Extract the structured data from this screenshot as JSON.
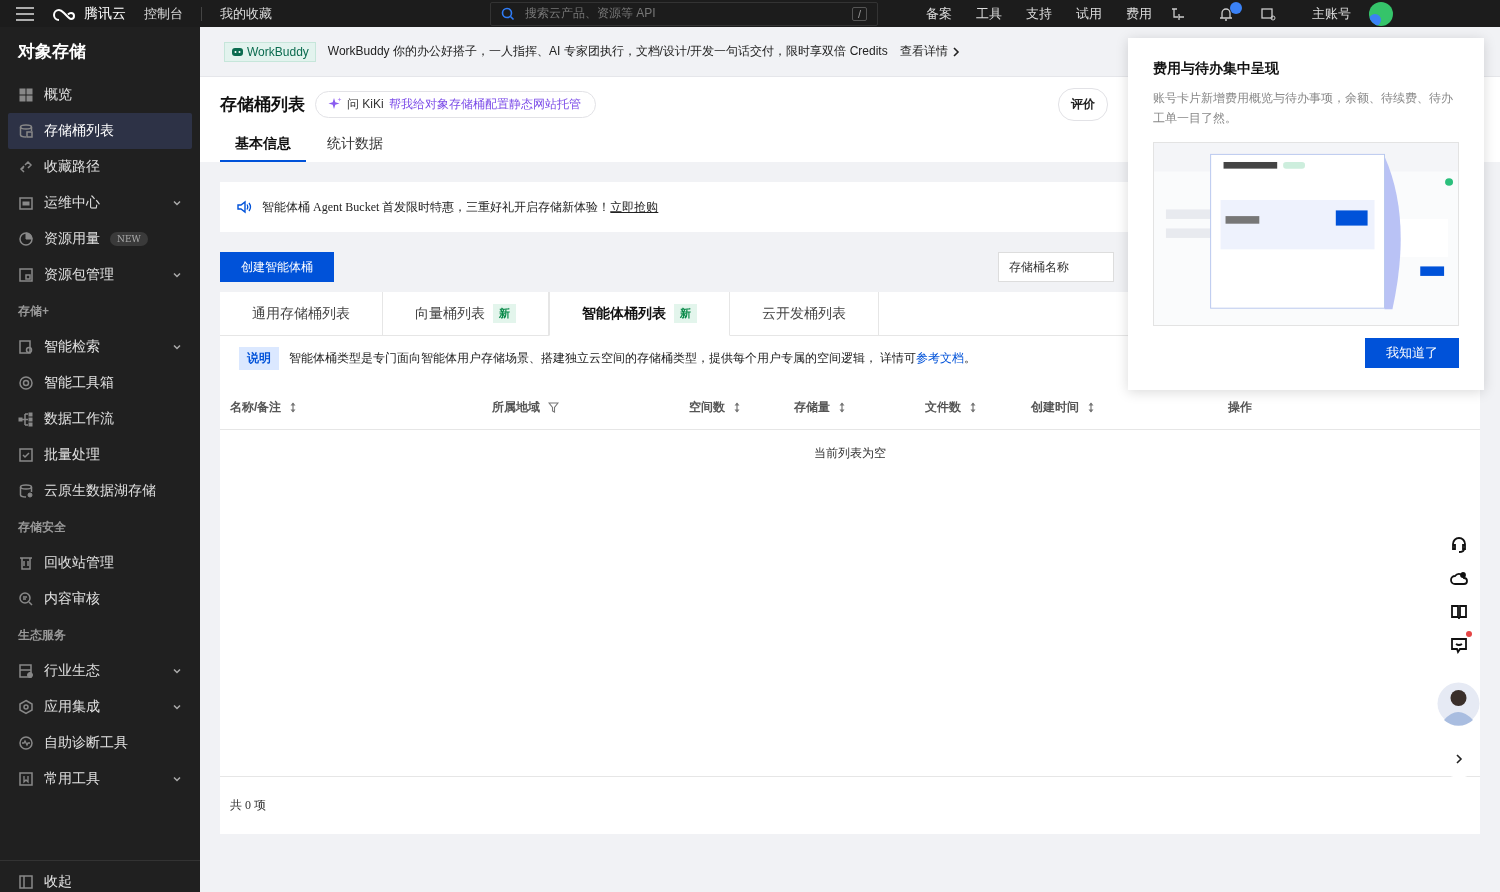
{
  "topbar": {
    "logo": "腾讯云",
    "console": "控制台",
    "favorites": "我的收藏",
    "search_placeholder": "搜索云产品、资源等 API",
    "search_key": "/",
    "links": [
      "备案",
      "工具",
      "支持",
      "试用",
      "费用"
    ],
    "account": "主账号"
  },
  "sidebar": {
    "title": "对象存储",
    "items": [
      {
        "kind": "item",
        "label": "概览",
        "selected": false
      },
      {
        "kind": "item",
        "label": "存储桶列表",
        "selected": true
      },
      {
        "kind": "item",
        "label": "收藏路径",
        "selected": false
      },
      {
        "kind": "item",
        "label": "运维中心",
        "selected": false,
        "expandable": true
      },
      {
        "kind": "item",
        "label": "资源用量",
        "selected": false,
        "badge": "NEW"
      },
      {
        "kind": "item",
        "label": "资源包管理",
        "selected": false,
        "expandable": true
      },
      {
        "kind": "section",
        "label": "存储+"
      },
      {
        "kind": "item",
        "label": "智能检索",
        "selected": false,
        "expandable": true
      },
      {
        "kind": "item",
        "label": "智能工具箱",
        "selected": false
      },
      {
        "kind": "item",
        "label": "数据工作流",
        "selected": false
      },
      {
        "kind": "item",
        "label": "批量处理",
        "selected": false
      },
      {
        "kind": "item",
        "label": "云原生数据湖存储",
        "selected": false
      },
      {
        "kind": "section",
        "label": "存储安全"
      },
      {
        "kind": "item",
        "label": "回收站管理",
        "selected": false
      },
      {
        "kind": "item",
        "label": "内容审核",
        "selected": false
      },
      {
        "kind": "section",
        "label": "生态服务"
      },
      {
        "kind": "item",
        "label": "行业生态",
        "selected": false,
        "expandable": true
      },
      {
        "kind": "item",
        "label": "应用集成",
        "selected": false,
        "expandable": true
      },
      {
        "kind": "item",
        "label": "自助诊断工具",
        "selected": false
      },
      {
        "kind": "item",
        "label": "常用工具",
        "selected": false,
        "expandable": true
      }
    ],
    "collapse": "收起"
  },
  "banner": {
    "tag": "WorkBuddy",
    "text": "WorkBuddy 你的办公好搭子，一人指挥、AI 专家团执行，文档/设计/开发一句话交付，限时享双倍 Credits",
    "link": "查看详情"
  },
  "header": {
    "title": "存储桶列表",
    "kiki_prefix": "问 KiKi",
    "kiki_text": "帮我给对象存储桶配置静态网站托管",
    "rate": "评价",
    "tabs": [
      {
        "label": "基本信息",
        "selected": true
      },
      {
        "label": "统计数据",
        "selected": false
      }
    ]
  },
  "notice": {
    "text": "智能体桶 Agent Bucket 首发限时特惠，三重好礼开启存储新体验！",
    "link": "立即抢购"
  },
  "create_button": "创建智能体桶",
  "search_placeholder": "存储桶名称",
  "bucket_tabs": [
    {
      "label": "通用存储桶列表",
      "selected": false
    },
    {
      "label": "向量桶列表",
      "badge": "新",
      "selected": false
    },
    {
      "label": "智能体桶列表",
      "badge": "新",
      "selected": true
    },
    {
      "label": "云开发桶列表",
      "selected": false
    }
  ],
  "info": {
    "tag": "说明",
    "text": "智能体桶类型是专门面向智能体用户存储场景、搭建独立云空间的存储桶类型，提供每个用户专属的空间逻辑， 详情可",
    "link": "参考文档",
    "tail": "。"
  },
  "table": {
    "columns": [
      {
        "label": "名称/备注",
        "kind": "sort"
      },
      {
        "label": "所属地域",
        "kind": "filter"
      },
      {
        "label": "空间数",
        "kind": "sort"
      },
      {
        "label": "存储量",
        "kind": "sort"
      },
      {
        "label": "文件数",
        "kind": "sort"
      },
      {
        "label": "创建时间",
        "kind": "sort"
      },
      {
        "label": "操作",
        "kind": "plain"
      }
    ],
    "empty": "当前列表为空",
    "footer": "共 0 项"
  },
  "popup": {
    "title": "费用与待办集中呈现",
    "text": "账号卡片新增费用概览与待办事项，余额、待续费、待办工单一目了然。",
    "button": "我知道了"
  },
  "float_tools": {
    "notification_dot": true
  }
}
